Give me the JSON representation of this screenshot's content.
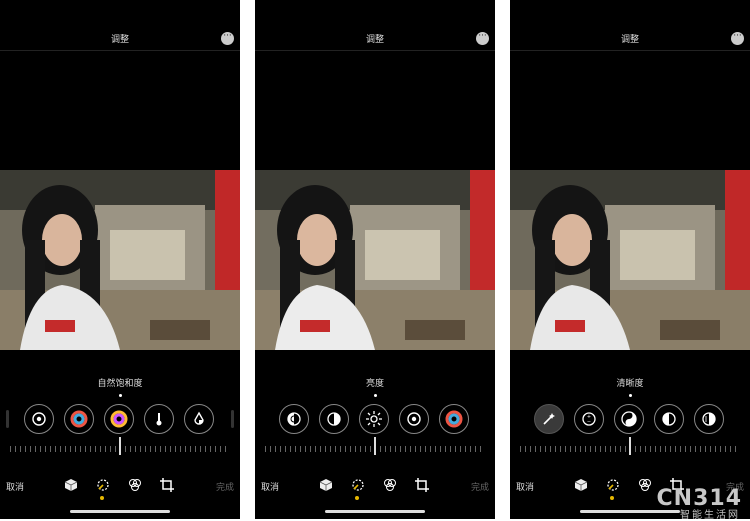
{
  "panels": [
    {
      "title": "调整",
      "adjustment_label": "自然饱和度",
      "cancel": "取消",
      "done": "完成"
    },
    {
      "title": "调整",
      "adjustment_label": "亮度",
      "cancel": "取消",
      "done": "完成"
    },
    {
      "title": "调整",
      "adjustment_label": "清晰度",
      "cancel": "取消",
      "done": "完成"
    }
  ],
  "watermark": {
    "main": "CN314",
    "sub": "智能生活网"
  },
  "colors": {
    "background": "#000000",
    "accent": "#e6b800",
    "text": "#dddddd"
  }
}
